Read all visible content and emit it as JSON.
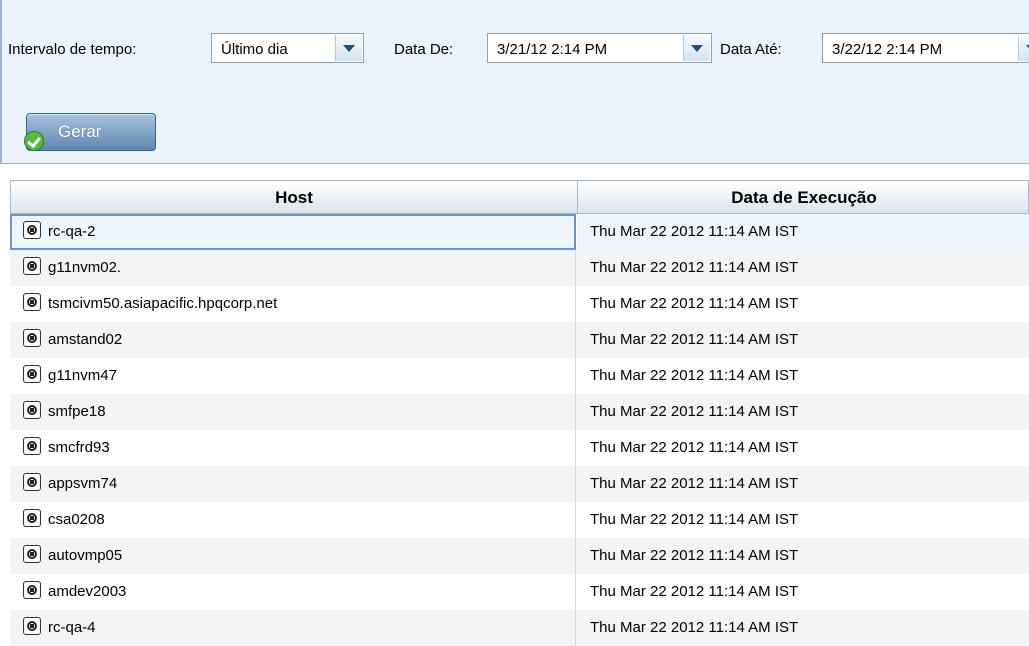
{
  "filters": {
    "interval_label": "Intervalo de tempo:",
    "interval_value": "Último dia",
    "from_label": "Data De:",
    "from_value": "3/21/12 2:14 PM",
    "to_label": "Data Até:",
    "to_value": "3/22/12 2:14 PM"
  },
  "actions": {
    "generate_label": "Gerar"
  },
  "table": {
    "headers": {
      "host": "Host",
      "date": "Data de Execução"
    },
    "rows": [
      {
        "host": "rc-qa-2",
        "date": "Thu Mar 22 2012 11:14 AM IST"
      },
      {
        "host": "g11nvm02.",
        "date": "Thu Mar 22 2012 11:14 AM IST"
      },
      {
        "host": "tsmcivm50.asiapacific.hpqcorp.net",
        "date": "Thu Mar 22 2012 11:14 AM IST"
      },
      {
        "host": "amstand02",
        "date": "Thu Mar 22 2012 11:14 AM IST"
      },
      {
        "host": "g11nvm47",
        "date": "Thu Mar 22 2012 11:14 AM IST"
      },
      {
        "host": "smfpe18",
        "date": "Thu Mar 22 2012 11:14 AM IST"
      },
      {
        "host": "smcfrd93",
        "date": "Thu Mar 22 2012 11:14 AM IST"
      },
      {
        "host": "appsvm74",
        "date": "Thu Mar 22 2012 11:14 AM IST"
      },
      {
        "host": "csa0208",
        "date": "Thu Mar 22 2012 11:14 AM IST"
      },
      {
        "host": "autovmp05",
        "date": "Thu Mar 22 2012 11:14 AM IST"
      },
      {
        "host": "amdev2003",
        "date": "Thu Mar 22 2012 11:14 AM IST"
      },
      {
        "host": "rc-qa-4",
        "date": "Thu Mar 22 2012 11:14 AM IST"
      }
    ],
    "selected_row": 0,
    "row_icon": "host-icon"
  }
}
